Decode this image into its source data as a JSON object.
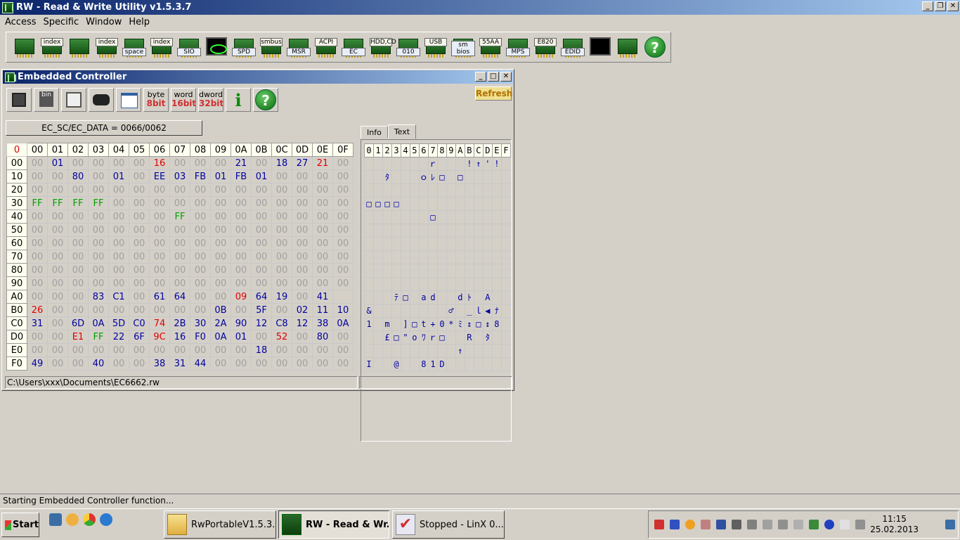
{
  "app": {
    "title": "RW - Read & Write Utility v1.5.3.7"
  },
  "menu": [
    "Access",
    "Specific",
    "Window",
    "Help"
  ],
  "toolbar": [
    {
      "name": "pci-tool",
      "icon": "chip-icon",
      "label": ""
    },
    {
      "name": "pci-index-tool",
      "icon": "chip-icon",
      "label": "index"
    },
    {
      "name": "memory-tool",
      "icon": "chip-icon",
      "label": ""
    },
    {
      "name": "memory-index-tool",
      "icon": "chip-icon",
      "label": "index"
    },
    {
      "name": "io-space-tool",
      "icon": "io-icon",
      "label": "space"
    },
    {
      "name": "io-index-tool",
      "icon": "io-icon",
      "label": "index"
    },
    {
      "name": "sio-tool",
      "icon": "chip-icon",
      "label": "SIO"
    },
    {
      "name": "scope-tool",
      "icon": "scope-icon",
      "label": ""
    },
    {
      "name": "spd-tool",
      "icon": "chip-icon",
      "label": "SPD"
    },
    {
      "name": "smbus-tool",
      "icon": "chip-icon",
      "label": "smbus"
    },
    {
      "name": "msr-tool",
      "icon": "chip-icon",
      "label": "MSR"
    },
    {
      "name": "acpi-tool",
      "icon": "chip-icon",
      "label": "ACPI"
    },
    {
      "name": "ec-tool",
      "icon": "chip-icon",
      "label": "EC"
    },
    {
      "name": "hdd-tool",
      "icon": "disk-icon",
      "label": "HDD,CD"
    },
    {
      "name": "io-read-tool",
      "icon": "disk-icon",
      "label": "010"
    },
    {
      "name": "usb-tool",
      "icon": "usb-icon",
      "label": "USB"
    },
    {
      "name": "smbios-tool",
      "icon": "chip-icon",
      "label": "sm bios"
    },
    {
      "name": "55aa-tool",
      "icon": "chip-icon",
      "label": "55AA"
    },
    {
      "name": "mps-tool",
      "icon": "chip-icon",
      "label": "MPS"
    },
    {
      "name": "e820-tool",
      "icon": "chip-icon",
      "label": "E820"
    },
    {
      "name": "edid-tool",
      "icon": "chip-icon",
      "label": "EDID"
    },
    {
      "name": "command-tool",
      "icon": "terminal-icon",
      "label": ""
    },
    {
      "name": "battery-tool",
      "icon": "battery-icon",
      "label": ""
    },
    {
      "name": "help-tool",
      "icon": "help-icon",
      "label": "?"
    }
  ],
  "ec": {
    "title": "Embedded Controller",
    "refresh_label": "Refresh",
    "port_label": "EC_SC/EC_DATA = 0066/0062",
    "tools": {
      "byte_top": "byte",
      "byte_bot": "8bit",
      "word_top": "word",
      "word_bot": "16bit",
      "dword_top": "dword",
      "dword_bot": "32bit",
      "info": "i",
      "help": "?"
    },
    "corner": "0",
    "columns": [
      "00",
      "01",
      "02",
      "03",
      "04",
      "05",
      "06",
      "07",
      "08",
      "09",
      "0A",
      "0B",
      "0C",
      "0D",
      "0E",
      "0F"
    ],
    "rows": [
      {
        "addr": "00",
        "cells": [
          "00",
          "01",
          "00",
          "00",
          "00",
          "00",
          "16",
          "00",
          "00",
          "00",
          "21",
          "00",
          "18",
          "27",
          "21",
          "00"
        ]
      },
      {
        "addr": "10",
        "cells": [
          "00",
          "00",
          "80",
          "00",
          "01",
          "00",
          "EE",
          "03",
          "FB",
          "01",
          "FB",
          "01",
          "00",
          "00",
          "00",
          "00"
        ]
      },
      {
        "addr": "20",
        "cells": [
          "00",
          "00",
          "00",
          "00",
          "00",
          "00",
          "00",
          "00",
          "00",
          "00",
          "00",
          "00",
          "00",
          "00",
          "00",
          "00"
        ]
      },
      {
        "addr": "30",
        "cells": [
          "FF",
          "FF",
          "FF",
          "FF",
          "00",
          "00",
          "00",
          "00",
          "00",
          "00",
          "00",
          "00",
          "00",
          "00",
          "00",
          "00"
        ]
      },
      {
        "addr": "40",
        "cells": [
          "00",
          "00",
          "00",
          "00",
          "00",
          "00",
          "00",
          "FF",
          "00",
          "00",
          "00",
          "00",
          "00",
          "00",
          "00",
          "00"
        ]
      },
      {
        "addr": "50",
        "cells": [
          "00",
          "00",
          "00",
          "00",
          "00",
          "00",
          "00",
          "00",
          "00",
          "00",
          "00",
          "00",
          "00",
          "00",
          "00",
          "00"
        ]
      },
      {
        "addr": "60",
        "cells": [
          "00",
          "00",
          "00",
          "00",
          "00",
          "00",
          "00",
          "00",
          "00",
          "00",
          "00",
          "00",
          "00",
          "00",
          "00",
          "00"
        ]
      },
      {
        "addr": "70",
        "cells": [
          "00",
          "00",
          "00",
          "00",
          "00",
          "00",
          "00",
          "00",
          "00",
          "00",
          "00",
          "00",
          "00",
          "00",
          "00",
          "00"
        ]
      },
      {
        "addr": "80",
        "cells": [
          "00",
          "00",
          "00",
          "00",
          "00",
          "00",
          "00",
          "00",
          "00",
          "00",
          "00",
          "00",
          "00",
          "00",
          "00",
          "00"
        ]
      },
      {
        "addr": "90",
        "cells": [
          "00",
          "00",
          "00",
          "00",
          "00",
          "00",
          "00",
          "00",
          "00",
          "00",
          "00",
          "00",
          "00",
          "00",
          "00",
          "00"
        ]
      },
      {
        "addr": "A0",
        "cells": [
          "00",
          "00",
          "00",
          "83",
          "C1",
          "00",
          "61",
          "64",
          "00",
          "00",
          "09",
          "64",
          "19",
          "00",
          "41",
          ""
        ]
      },
      {
        "addr": "B0",
        "cells": [
          "26",
          "00",
          "00",
          "00",
          "00",
          "00",
          "00",
          "00",
          "00",
          "0B",
          "00",
          "5F",
          "00",
          "02",
          "11",
          "10"
        ]
      },
      {
        "addr": "C0",
        "cells": [
          "31",
          "00",
          "6D",
          "0A",
          "5D",
          "C0",
          "74",
          "2B",
          "30",
          "2A",
          "90",
          "12",
          "C8",
          "12",
          "38",
          "0A"
        ]
      },
      {
        "addr": "D0",
        "cells": [
          "00",
          "00",
          "E1",
          "FF",
          "22",
          "6F",
          "9C",
          "16",
          "F0",
          "0A",
          "01",
          "00",
          "52",
          "00",
          "80",
          "00"
        ]
      },
      {
        "addr": "E0",
        "cells": [
          "00",
          "00",
          "00",
          "00",
          "00",
          "00",
          "00",
          "00",
          "00",
          "00",
          "00",
          "18",
          "00",
          "00",
          "00",
          "00"
        ]
      },
      {
        "addr": "F0",
        "cells": [
          "49",
          "00",
          "00",
          "40",
          "00",
          "00",
          "38",
          "31",
          "44",
          "00",
          "00",
          "00",
          "00",
          "00",
          "00",
          "00"
        ]
      }
    ],
    "tabs": {
      "info": "Info",
      "text": "Text"
    },
    "text_columns": [
      "0",
      "1",
      "2",
      "3",
      "4",
      "5",
      "6",
      "7",
      "8",
      "9",
      "A",
      "B",
      "C",
      "D",
      "E",
      "F"
    ],
    "text_rows": [
      [
        "",
        "",
        "",
        "",
        "",
        "",
        "",
        "ｒ",
        "",
        "",
        "",
        "!",
        "↑",
        "'",
        "!",
        ""
      ],
      [
        "",
        "",
        "ﾀ",
        "",
        "",
        "",
        "ｏ",
        "ﾚ",
        "□",
        "",
        "□",
        "",
        "",
        "",
        "",
        ""
      ],
      [
        "",
        "",
        "",
        "",
        "",
        "",
        "",
        "",
        "",
        "",
        "",
        "",
        "",
        "",
        "",
        ""
      ],
      [
        "□",
        "□",
        "□",
        "□",
        "",
        "",
        "",
        "",
        "",
        "",
        "",
        "",
        "",
        "",
        "",
        ""
      ],
      [
        "",
        "",
        "",
        "",
        "",
        "",
        "",
        "□",
        "",
        "",
        "",
        "",
        "",
        "",
        "",
        ""
      ],
      [
        "",
        "",
        "",
        "",
        "",
        "",
        "",
        "",
        "",
        "",
        "",
        "",
        "",
        "",
        "",
        ""
      ],
      [
        "",
        "",
        "",
        "",
        "",
        "",
        "",
        "",
        "",
        "",
        "",
        "",
        "",
        "",
        "",
        ""
      ],
      [
        "",
        "",
        "",
        "",
        "",
        "",
        "",
        "",
        "",
        "",
        "",
        "",
        "",
        "",
        "",
        ""
      ],
      [
        "",
        "",
        "",
        "",
        "",
        "",
        "",
        "",
        "",
        "",
        "",
        "",
        "",
        "",
        "",
        ""
      ],
      [
        "",
        "",
        "",
        "",
        "",
        "",
        "",
        "",
        "",
        "",
        "",
        "",
        "",
        "",
        "",
        ""
      ],
      [
        "",
        "",
        "",
        "ﾃ",
        "□",
        "",
        "a",
        "d",
        "",
        "",
        "d",
        "ﾄ",
        "",
        "A",
        "",
        ""
      ],
      [
        "&",
        "",
        "",
        "",
        "",
        "",
        "",
        "",
        "",
        "♂",
        "",
        "_",
        "ｌ",
        "◀",
        "ﾅ",
        ""
      ],
      [
        "1",
        "",
        "m",
        "",
        "]",
        "□",
        "t",
        "+",
        "0",
        "*",
        "ﾐ",
        "↕",
        "□",
        "↕",
        "8",
        ""
      ],
      [
        "",
        "",
        "£",
        "□",
        "\"",
        "o",
        "ﾜ",
        "ｒ",
        "□",
        "",
        "",
        "R",
        "",
        "ﾀ",
        "",
        ""
      ],
      [
        "",
        "",
        "",
        "",
        "",
        "",
        "",
        "",
        "",
        "",
        "↑",
        "",
        "",
        "",
        "",
        ""
      ],
      [
        "I",
        "",
        "",
        "@",
        "",
        "",
        "8",
        "1",
        "D",
        "",
        "",
        "",
        "",
        "",
        "",
        ""
      ]
    ],
    "file_path": "C:\\Users\\xxx\\Documents\\EC6662.rw"
  },
  "status_text": "Starting Embedded Controller function...",
  "taskbar": {
    "start_label": "Start",
    "tasks": [
      {
        "name": "task-rwportable",
        "label": "RwPortableV1.5.3.7",
        "icon": "folder-icon"
      },
      {
        "name": "task-rw",
        "label": "RW - Read & Wr...",
        "icon": "rw-app-icon",
        "active": true
      },
      {
        "name": "task-linx",
        "label": "Stopped - LinX 0....",
        "icon": "check-icon"
      }
    ],
    "time": "11:15",
    "date": "25.02.2013"
  }
}
